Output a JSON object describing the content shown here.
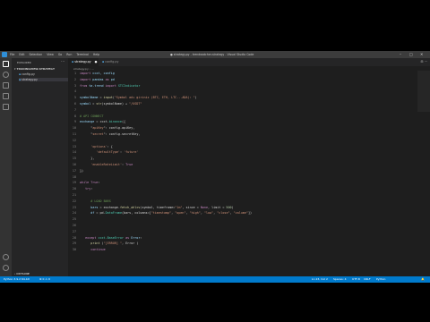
{
  "menu": [
    "File",
    "Edit",
    "Selection",
    "View",
    "Go",
    "Run",
    "Terminal",
    "Help"
  ],
  "window_title": "● strategy.py - trendwatcher-strategy - Visual Studio Code",
  "window_controls": [
    "–",
    "□",
    "✕"
  ],
  "sidebar": {
    "header": "EXPLORER",
    "folder": "▾ TRADINGVIEW-STRATEGY",
    "files": [
      "config.py",
      "strategy.py"
    ],
    "outline": "› OUTLINE"
  },
  "tabs": [
    {
      "label": "strategy.py",
      "close": "●"
    },
    {
      "label": "config.py",
      "close": ""
    }
  ],
  "tab_actions": "⊟ ···",
  "breadcrumb": "strategy.py › ...",
  "code_lines": [
    {
      "n": "1",
      "t": [
        {
          "c": "kw",
          "v": "import "
        },
        {
          "c": "var",
          "v": "ccxt, config"
        }
      ]
    },
    {
      "n": "2",
      "t": [
        {
          "c": "kw",
          "v": "import "
        },
        {
          "c": "var",
          "v": "pandas "
        },
        {
          "c": "kw",
          "v": "as "
        },
        {
          "c": "var",
          "v": "pd"
        }
      ]
    },
    {
      "n": "3",
      "t": [
        {
          "c": "kw",
          "v": "from "
        },
        {
          "c": "var",
          "v": "ta.trend "
        },
        {
          "c": "kw",
          "v": "import "
        },
        {
          "c": "cls",
          "v": "STCIndicator"
        }
      ]
    },
    {
      "n": "4",
      "t": []
    },
    {
      "n": "5",
      "t": [
        {
          "c": "var",
          "v": "symbolName"
        },
        {
          "c": "pl",
          "v": " = "
        },
        {
          "c": "fn",
          "v": "input"
        },
        {
          "c": "pl",
          "v": "("
        },
        {
          "c": "str",
          "v": "\"Symbol adı giriniz (BTC, ETH, LTC...ADA): \""
        },
        {
          "c": "pl",
          "v": ")"
        }
      ]
    },
    {
      "n": "6",
      "t": [
        {
          "c": "var",
          "v": "symbol"
        },
        {
          "c": "pl",
          "v": " = "
        },
        {
          "c": "fn",
          "v": "str"
        },
        {
          "c": "pl",
          "v": "(symbolName) + "
        },
        {
          "c": "str",
          "v": "\"/USDT\""
        }
      ]
    },
    {
      "n": "7",
      "t": []
    },
    {
      "n": "8",
      "t": [
        {
          "c": "cm",
          "v": "# API CONNECT"
        }
      ]
    },
    {
      "n": "9",
      "t": [
        {
          "c": "var",
          "v": "exchange"
        },
        {
          "c": "pl",
          "v": " = ccxt."
        },
        {
          "c": "cls",
          "v": "binance"
        },
        {
          "c": "pl",
          "v": "({"
        }
      ]
    },
    {
      "n": "10",
      "t": [
        {
          "c": "pl",
          "v": "\""
        },
        {
          "c": "str",
          "v": "apiKey"
        },
        {
          "c": "pl",
          "v": "\": config.apiKey,"
        }
      ]
    },
    {
      "n": "11",
      "t": [
        {
          "c": "pl",
          "v": "\""
        },
        {
          "c": "str",
          "v": "secret"
        },
        {
          "c": "pl",
          "v": "\": config.secretKey,"
        }
      ]
    },
    {
      "n": "12",
      "t": []
    },
    {
      "n": "13",
      "t": [
        {
          "c": "str",
          "v": "'options'"
        },
        {
          "c": "pl",
          "v": ": {"
        }
      ]
    },
    {
      "n": "14",
      "t": [
        {
          "c": "str",
          "v": "'defaultType'"
        },
        {
          "c": "pl",
          "v": ": "
        },
        {
          "c": "str",
          "v": "'future'"
        }
      ]
    },
    {
      "n": "15",
      "t": [
        {
          "c": "pl",
          "v": "},"
        }
      ]
    },
    {
      "n": "16",
      "t": [
        {
          "c": "str",
          "v": "'enableRateLimit'"
        },
        {
          "c": "pl",
          "v": ": "
        },
        {
          "c": "kw",
          "v": "True"
        }
      ]
    },
    {
      "n": "17",
      "t": [
        {
          "c": "pl",
          "v": "})"
        }
      ]
    },
    {
      "n": "18",
      "t": []
    },
    {
      "n": "19",
      "t": [
        {
          "c": "kw",
          "v": "while "
        },
        {
          "c": "kw",
          "v": "True"
        },
        {
          "c": "pl",
          "v": ":"
        }
      ]
    },
    {
      "n": "20",
      "t": [
        {
          "c": "kw",
          "v": "try"
        },
        {
          "c": "pl",
          "v": ":"
        }
      ]
    },
    {
      "n": "21",
      "t": []
    },
    {
      "n": "22",
      "t": [
        {
          "c": "cm",
          "v": "# LOAD BARS"
        }
      ]
    },
    {
      "n": "23",
      "t": [
        {
          "c": "var",
          "v": "bars"
        },
        {
          "c": "pl",
          "v": " = exchange."
        },
        {
          "c": "fn",
          "v": "fetch_ohlcv"
        },
        {
          "c": "pl",
          "v": "(symbol, timeframe="
        },
        {
          "c": "str",
          "v": "\"1m\""
        },
        {
          "c": "pl",
          "v": ", since = "
        },
        {
          "c": "kw",
          "v": "None"
        },
        {
          "c": "pl",
          "v": ", limit = "
        },
        {
          "c": "num",
          "v": "500"
        },
        {
          "c": "pl",
          "v": ")"
        }
      ]
    },
    {
      "n": "24",
      "t": [
        {
          "c": "var",
          "v": "df"
        },
        {
          "c": "pl",
          "v": " = pd."
        },
        {
          "c": "cls",
          "v": "DataFrame"
        },
        {
          "c": "pl",
          "v": "(bars, columns=["
        },
        {
          "c": "str",
          "v": "\"timestamp\""
        },
        {
          "c": "pl",
          "v": ", "
        },
        {
          "c": "str",
          "v": "\"open\""
        },
        {
          "c": "pl",
          "v": ", "
        },
        {
          "c": "str",
          "v": "\"high\""
        },
        {
          "c": "pl",
          "v": ", "
        },
        {
          "c": "str",
          "v": "\"low\""
        },
        {
          "c": "pl",
          "v": ", "
        },
        {
          "c": "str",
          "v": "\"close\""
        },
        {
          "c": "pl",
          "v": ", "
        },
        {
          "c": "str",
          "v": "\"volume\""
        },
        {
          "c": "pl",
          "v": "])"
        }
      ]
    },
    {
      "n": "25",
      "t": []
    },
    {
      "n": "26",
      "t": []
    },
    {
      "n": "27",
      "t": []
    },
    {
      "n": "28",
      "t": [
        {
          "c": "kw",
          "v": "except "
        },
        {
          "c": "cls",
          "v": "ccxt.BaseError "
        },
        {
          "c": "kw",
          "v": "as "
        },
        {
          "c": "var",
          "v": "Error"
        },
        {
          "c": "pl",
          "v": ":"
        }
      ]
    },
    {
      "n": "29",
      "t": [
        {
          "c": "fn",
          "v": "print"
        },
        {
          "c": "pl",
          "v": " ("
        },
        {
          "c": "str",
          "v": "\"[ERROR] \""
        },
        {
          "c": "pl",
          "v": ", Error )"
        }
      ]
    },
    {
      "n": "30",
      "t": [
        {
          "c": "kw",
          "v": "continue"
        }
      ]
    }
  ],
  "status": {
    "left": "Python 3.9.2 64-bit",
    "issues": "⊗ 0 ⚠ 0",
    "position": "Ln 23, Col 2",
    "spaces": "Spaces: 4",
    "encoding": "UTF-8",
    "eol": "CRLF",
    "lang": "Python",
    "bell": "🔔"
  },
  "colors": {
    "accent": "#007acc",
    "editor_bg": "#1e1e1e",
    "sidebar_bg": "#252526"
  }
}
